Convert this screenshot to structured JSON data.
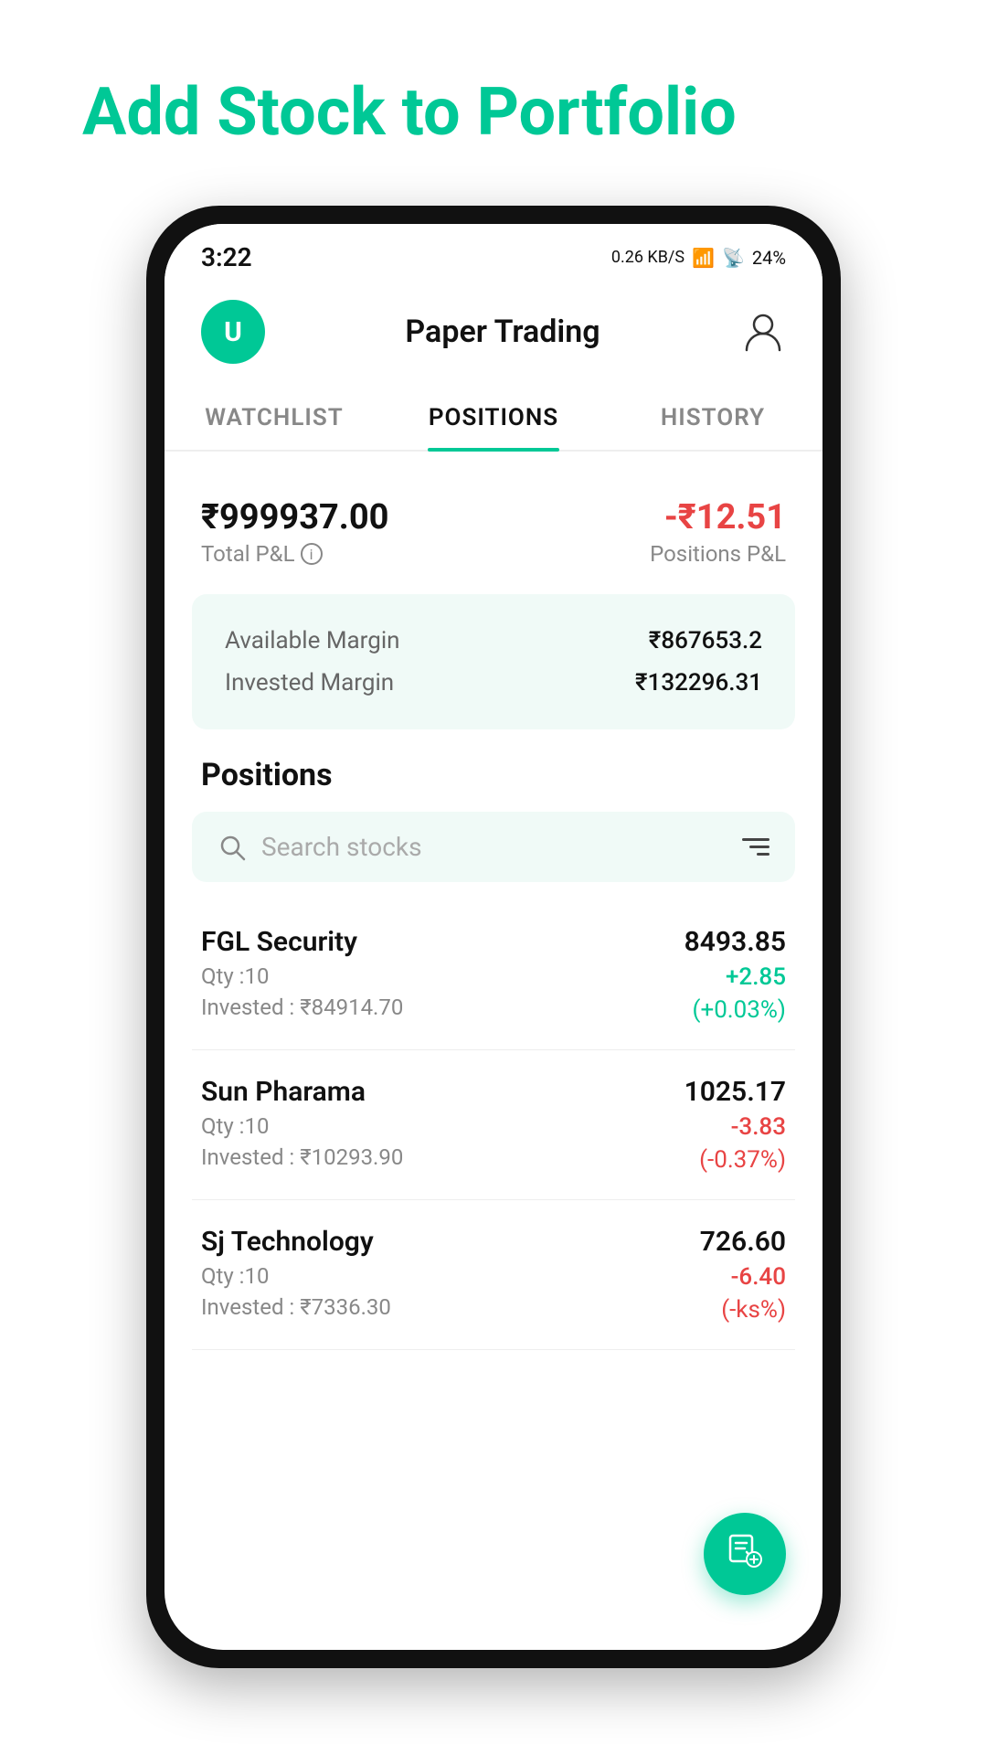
{
  "page": {
    "title_part1": "Add Stock to ",
    "title_part2": "Portfolio"
  },
  "status_bar": {
    "time": "3:22",
    "network_speed": "0.26 KB/S",
    "battery": "24%"
  },
  "header": {
    "avatar_letter": "U",
    "title": "Paper Trading",
    "profile_icon": "👤"
  },
  "tabs": [
    {
      "id": "watchlist",
      "label": "WATCHLIST",
      "active": false
    },
    {
      "id": "positions",
      "label": "POSITIONS",
      "active": true
    },
    {
      "id": "history",
      "label": "HISTORY",
      "active": false
    }
  ],
  "summary": {
    "total_pnl_value": "₹999937.00",
    "total_pnl_label": "Total P&L",
    "positions_pnl_value": "-₹12.51",
    "positions_pnl_label": "Positions P&L"
  },
  "margin": {
    "available_label": "Available Margin",
    "available_value": "₹867653.2",
    "invested_label": "Invested Margin",
    "invested_value": "₹132296.31"
  },
  "positions": {
    "heading": "Positions",
    "search_placeholder": "Search stocks",
    "stocks": [
      {
        "name": "FGL Security",
        "qty": "Qty :10",
        "invested": "Invested : ₹84914.70",
        "price": "8493.85",
        "change": "+2.85",
        "change_pct": "(+0.03%)",
        "positive": true
      },
      {
        "name": "Sun Pharama",
        "qty": "Qty :10",
        "invested": "Invested : ₹10293.90",
        "price": "1025.17",
        "change": "-3.83",
        "change_pct": "(-0.37%)",
        "positive": false
      },
      {
        "name": "Sj Technology",
        "qty": "Qty :10",
        "invested": "Invested : ₹7336.30",
        "price": "726.60",
        "change": "-6.40",
        "change_pct": "(-ks%)",
        "positive": false
      }
    ]
  }
}
